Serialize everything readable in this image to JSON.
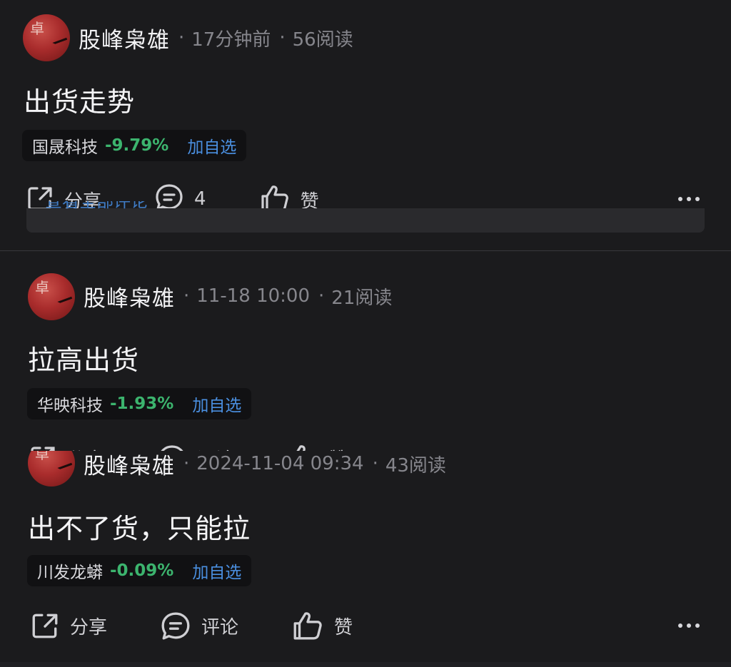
{
  "posts": [
    {
      "author": "股峰枭雄",
      "time": "17分钟前",
      "reads": "56阅读",
      "title": "出货走势",
      "stock": {
        "name": "国晟科技",
        "change": "-9.79%",
        "add": "加自选"
      },
      "actions": {
        "share": "分享",
        "comment": "4",
        "like": "赞"
      }
    },
    {
      "author": "股峰枭雄",
      "time": "11-18 10:00",
      "reads": "21阅读",
      "title": "拉高出货",
      "stock": {
        "name": "华映科技",
        "change": "-1.93%",
        "add": "加自选"
      },
      "actions": {
        "share": "分享",
        "comment": "评论",
        "like": "赞"
      }
    },
    {
      "author": "股峰枭雄",
      "time": "2024-11-04 09:34",
      "reads": "43阅读",
      "title": "出不了货，只能拉",
      "stock": {
        "name": "川发龙蟒",
        "change": "-0.09%",
        "add": "加自选"
      },
      "actions": {
        "share": "分享",
        "comment": "评论",
        "like": "赞"
      }
    }
  ],
  "overlay": {
    "link": "查看全部评论"
  },
  "icons": [
    "share-icon",
    "comment-icon",
    "like-icon",
    "more-icon"
  ],
  "colors": {
    "background": "#1b1b1d",
    "down_green": "#3cb46e",
    "link_blue": "#4a8fe0"
  }
}
